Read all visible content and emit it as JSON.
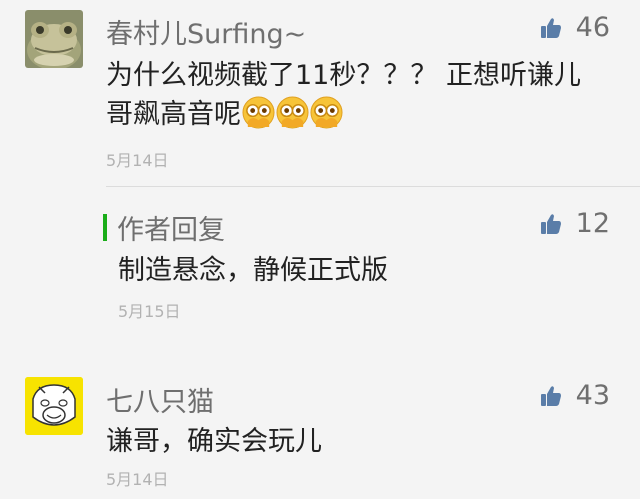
{
  "comments": [
    {
      "nickname": "春村儿Surfing~",
      "likes": "46",
      "text_line1": "为什么视频截了11秒？？？ 正想听谦儿",
      "text_line2": "哥飙高音呢",
      "emojis": [
        "peeking-face-emoji",
        "peeking-face-emoji",
        "peeking-face-emoji"
      ],
      "date": "5月14日"
    },
    {
      "nickname": "七八只猫",
      "likes": "43",
      "text": "谦哥，确实会玩儿",
      "date": "5月14日"
    }
  ],
  "author_reply": {
    "label": "作者回复",
    "likes": "12",
    "text": "制造悬念，静候正式版",
    "date": "5月15日"
  },
  "colors": {
    "accent_green": "#1aad19",
    "like_icon": "#5a7da8"
  }
}
